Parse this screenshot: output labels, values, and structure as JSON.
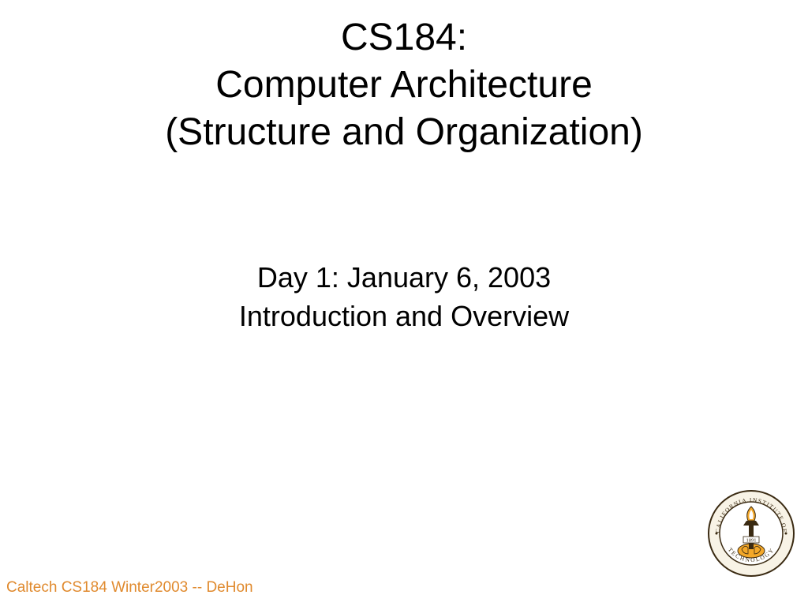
{
  "title": {
    "line1": "CS184:",
    "line2": "Computer Architecture",
    "line3": "(Structure and Organization)"
  },
  "subtitle": {
    "line1": "Day 1:  January 6, 2003",
    "line2": "Introduction and Overview"
  },
  "footer": "Caltech CS184 Winter2003 -- DeHon",
  "seal": {
    "ring_text_top": "CALIFORNIA INSTITUTE OF",
    "ring_text_bottom": "TECHNOLOGY",
    "year": "1891"
  },
  "colors": {
    "text": "#000000",
    "accent": "#e08a2e",
    "seal_gold": "#f4a829",
    "seal_dark": "#3a2a12"
  }
}
